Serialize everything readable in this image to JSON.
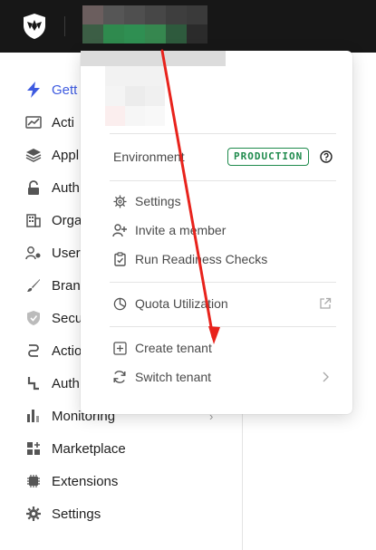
{
  "topbar": {
    "logo_icon": "auth0-shield-icon"
  },
  "sidebar": {
    "items": [
      {
        "label": "Gett",
        "icon": "lightning-icon",
        "active": true
      },
      {
        "label": "Acti",
        "icon": "activity-chart-icon"
      },
      {
        "label": "Appl",
        "icon": "layers-icon"
      },
      {
        "label": "Auth",
        "icon": "lock-icon"
      },
      {
        "label": "Orga",
        "icon": "building-icon"
      },
      {
        "label": "User",
        "icon": "user-management-icon"
      },
      {
        "label": "Bran",
        "icon": "brush-icon"
      },
      {
        "label": "Secu",
        "icon": "shield-check-icon"
      },
      {
        "label": "Actio",
        "icon": "flow-icon"
      },
      {
        "label": "Auth",
        "icon": "pipeline-icon"
      },
      {
        "label": "Monitoring",
        "icon": "bar-chart-icon",
        "chevron": true
      },
      {
        "label": "Marketplace",
        "icon": "grid-plus-icon"
      },
      {
        "label": "Extensions",
        "icon": "chip-icon"
      },
      {
        "label": "Settings",
        "icon": "gear-icon"
      }
    ]
  },
  "tenant_menu": {
    "environment_label": "Environment",
    "environment_badge": "PRODUCTION",
    "help_icon": "question-circle-icon",
    "items": [
      {
        "label": "Settings",
        "icon": "gear-icon"
      },
      {
        "label": "Invite a member",
        "icon": "user-plus-icon"
      },
      {
        "label": "Run Readiness Checks",
        "icon": "clipboard-check-icon"
      },
      {
        "label": "Quota Utilization",
        "icon": "pie-chart-icon",
        "trailing_icon": "external-link-icon"
      },
      {
        "label": "Create tenant",
        "icon": "plus-square-icon"
      },
      {
        "label": "Switch tenant",
        "icon": "refresh-icon",
        "trailing_icon": "chevron-right-icon"
      }
    ]
  },
  "colors": {
    "topbar": "#171717",
    "active_nav": "#3d5ae0",
    "badge_green": "#1e8a4c",
    "annotation_arrow": "#e8231c"
  }
}
